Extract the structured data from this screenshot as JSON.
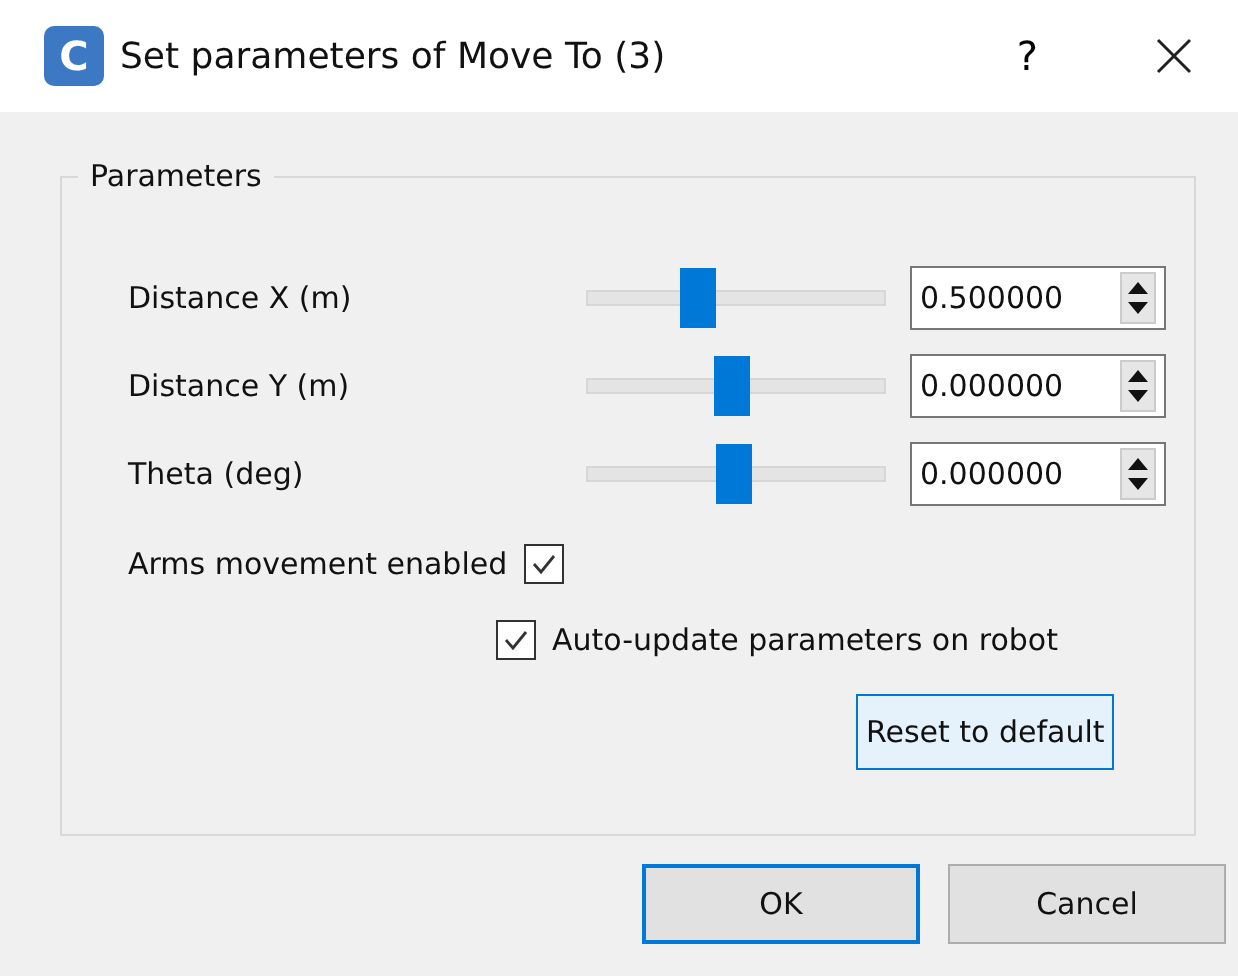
{
  "window": {
    "logo_letter": "C",
    "title": "Set parameters of Move To (3)",
    "help": "?"
  },
  "group": {
    "title": "Parameters",
    "rows": [
      {
        "label": "Distance X (m)",
        "level": 0.38,
        "value": "0.500000"
      },
      {
        "label": "Distance Y (m)",
        "level": 0.49,
        "value": "0.000000"
      },
      {
        "label": "Theta (deg)",
        "level": 0.5,
        "value": "0.000000"
      }
    ],
    "arms": {
      "label": "Arms movement enabled",
      "checked": true
    },
    "auto_update": {
      "label": "Auto-update parameters on robot",
      "checked": true
    },
    "reset": "Reset to default"
  },
  "buttons": [
    {
      "label": "OK",
      "selected": true
    },
    {
      "label": "Cancel",
      "selected": false
    }
  ]
}
